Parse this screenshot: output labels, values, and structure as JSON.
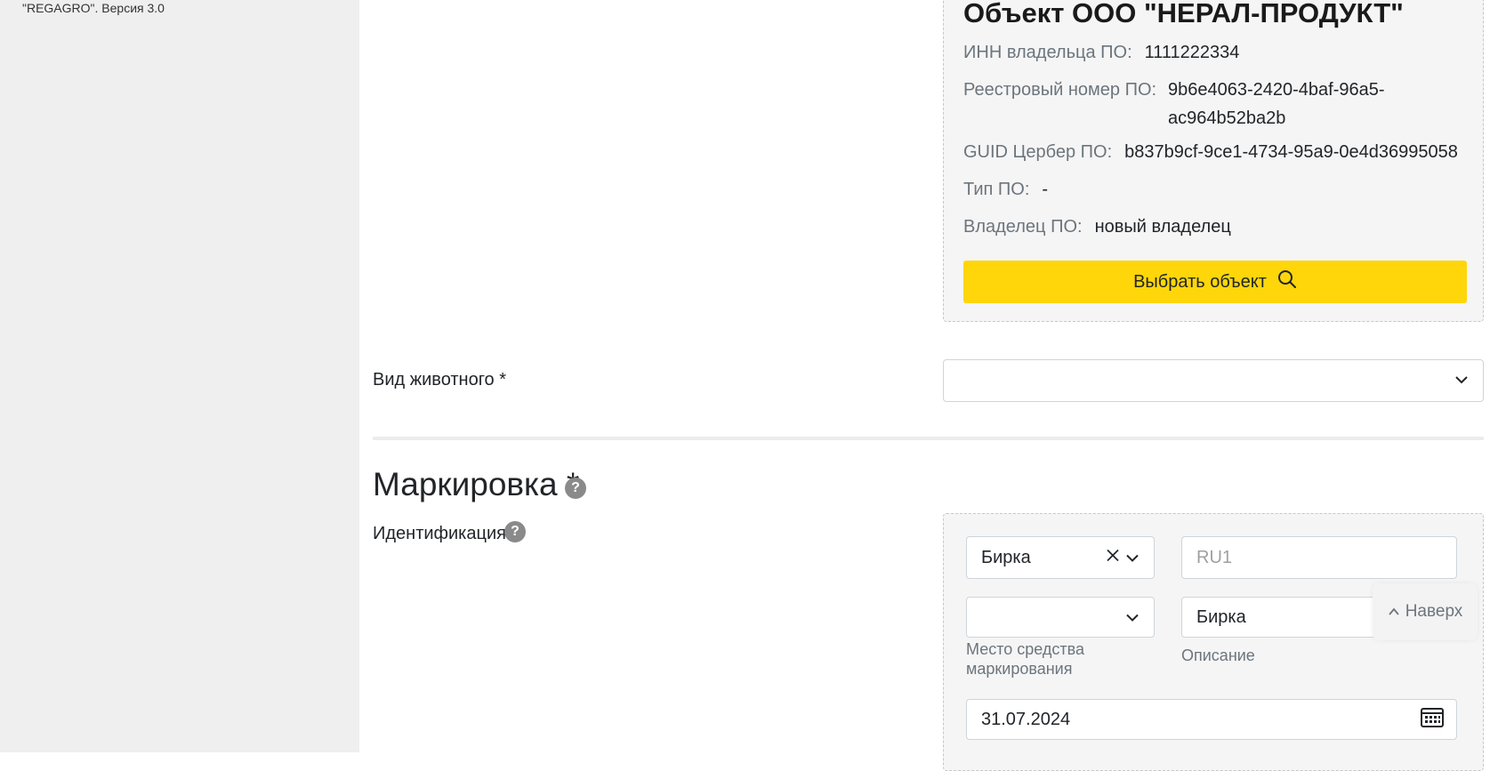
{
  "sidebar": {
    "version_text": "\"REGAGRO\". Версия 3.0"
  },
  "object_card": {
    "title": "Объект ООО \"НЕРАЛ-ПРОДУКТ\"",
    "inn_label": "ИНН владельца ПО:",
    "inn_value": "1111222334",
    "registry_label": "Реестровый номер ПО:",
    "registry_value": "9b6e4063-2420-4baf-96a5-ac964b52ba2b",
    "guid_label": "GUID Цербер ПО:",
    "guid_value": "b837b9cf-9ce1-4734-95a9-0e4d36995058",
    "type_label": "Тип ПО:",
    "type_value": "-",
    "owner_label": "Владелец ПО:",
    "owner_value": "новый владелец",
    "select_button": "Выбрать объект"
  },
  "animal": {
    "label": "Вид животного *",
    "value": ""
  },
  "marking": {
    "title": "Маркировка *",
    "identification_label": "Идентификация",
    "type_value": "Бирка",
    "number_placeholder": "RU1",
    "place_value": "",
    "place_caption": "Место средства маркирования",
    "description_value": "Бирка",
    "description_caption": "Описание",
    "date_value": "31.07.2024"
  },
  "back_to_top": "Наверх",
  "colors": {
    "accent": "#ffd60a",
    "sidebar_bg": "#efefef",
    "card_bg": "#f5f5f5"
  }
}
